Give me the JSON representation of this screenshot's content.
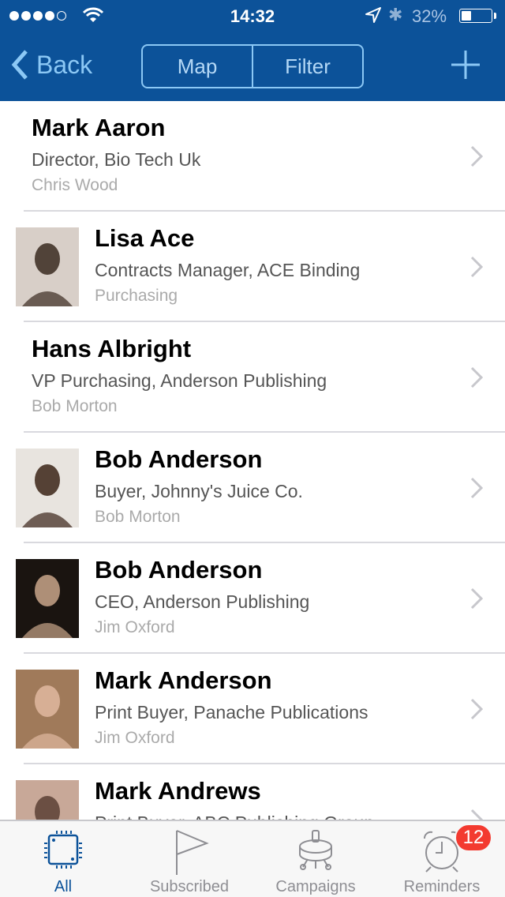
{
  "status_bar": {
    "signal_bars_filled": 4,
    "signal_bars_total": 5,
    "time": "14:32",
    "battery_percent_label": "32%",
    "battery_level": 0.32
  },
  "nav": {
    "back_label": "Back",
    "segments": [
      "Map",
      "Filter"
    ],
    "add_icon": "plus-icon"
  },
  "contacts": [
    {
      "name": "Mark Aaron",
      "title": "Director, Bio Tech Uk",
      "owner": "Chris Wood",
      "has_photo": false
    },
    {
      "name": "Lisa Ace",
      "title": "Contracts Manager, ACE Binding",
      "owner": "Purchasing",
      "has_photo": true
    },
    {
      "name": "Hans Albright",
      "title": "VP Purchasing, Anderson Publishing",
      "owner": "Bob Morton",
      "has_photo": false
    },
    {
      "name": "Bob Anderson",
      "title": "Buyer, Johnny's Juice Co.",
      "owner": "Bob Morton",
      "has_photo": true
    },
    {
      "name": "Bob Anderson",
      "title": "CEO, Anderson Publishing",
      "owner": "Jim Oxford",
      "has_photo": true
    },
    {
      "name": "Mark Anderson",
      "title": "Print Buyer, Panache Publications",
      "owner": "Jim Oxford",
      "has_photo": true
    },
    {
      "name": "Mark Andrews",
      "title": "Print Buyer, ABC Publishing Group",
      "owner": "",
      "has_photo": true
    }
  ],
  "tabbar": {
    "tabs": [
      {
        "label": "All",
        "icon": "chip-icon",
        "active": true
      },
      {
        "label": "Subscribed",
        "icon": "flag-icon",
        "active": false
      },
      {
        "label": "Campaigns",
        "icon": "potentiometer-icon",
        "active": false
      },
      {
        "label": "Reminders",
        "icon": "alarm-clock-icon",
        "active": false
      }
    ],
    "reminders_badge": "12"
  },
  "colors": {
    "nav_bg": "#0c5299",
    "nav_tint": "#8cc8f5",
    "badge": "#f33a30"
  }
}
